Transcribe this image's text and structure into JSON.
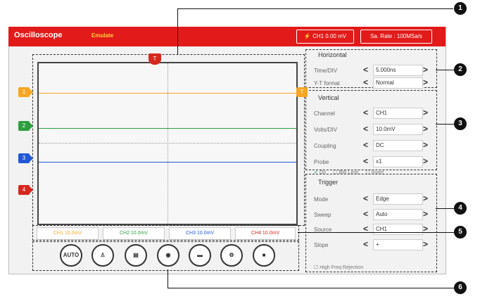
{
  "header": {
    "title": "Oscilloscope",
    "mode": "Emulate",
    "ch1_button": "CH1 0.00 mV",
    "sample_rate": "Sa. Rate : 100MSa/s"
  },
  "markers": {
    "trigger": "T",
    "ch1": "1",
    "ch2": "2",
    "ch3": "3",
    "ch4": "4",
    "level": "T"
  },
  "horizontal": {
    "title": "Horizontal",
    "time_label": "Time/DIV",
    "time_value": "5.000ns",
    "yt_label": "Y-T format",
    "yt_value": "Normal"
  },
  "vertical": {
    "title": "Vertical",
    "channel_label": "Channel",
    "channel_value": "CH1",
    "volts_label": "Volts/DIV",
    "volts_value": "10.0mV",
    "coupling_label": "Coupling",
    "coupling_value": "DC",
    "probe_label": "Probe",
    "probe_value": "x1",
    "on": "On",
    "bw": "BW Limit",
    "inverted": "Invert"
  },
  "trigger": {
    "title": "Trigger",
    "mode_label": "Mode",
    "mode_value": "Edge",
    "sweep_label": "Sweep",
    "sweep_value": "Auto",
    "source_label": "Source",
    "source_value": "CH1",
    "slope_label": "Slope",
    "slope_value": "+",
    "hf": "High Freq Rejection"
  },
  "channels": {
    "ch1": "CH1 10.0mV",
    "ch2": "CH2 10.0mV",
    "ch3": "CH3 10.0mV",
    "ch4": "CH4 10.0mV"
  },
  "toolbar": {
    "auto": "AUTO"
  },
  "callouts": {
    "c1": "1",
    "c2": "2",
    "c3": "3",
    "c4": "4",
    "c5": "5",
    "c6": "6"
  },
  "colors": {
    "ch1": "#f5a623",
    "ch2": "#2e9e3e",
    "ch3": "#2157d6",
    "ch4": "#d6281f",
    "header": "#e21a1a"
  }
}
